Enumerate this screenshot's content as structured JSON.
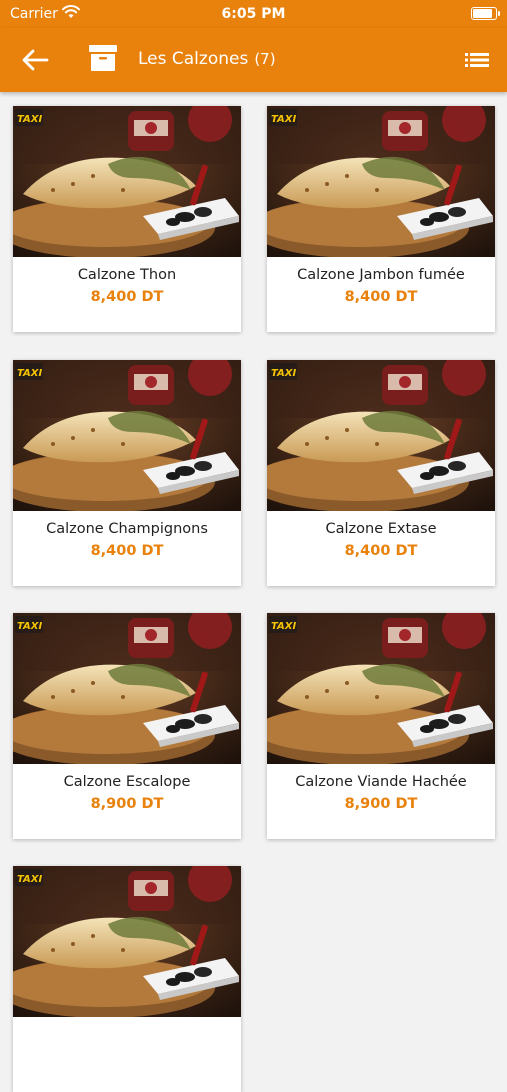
{
  "status_bar": {
    "carrier": "Carrier",
    "time": "6:05 PM",
    "battery_level": 0.9
  },
  "app_bar": {
    "title": "Les Calzones",
    "count": "(7)"
  },
  "colors": {
    "accent": "#e8820c"
  },
  "icons": {
    "back": "arrow-left-icon",
    "category": "box-icon",
    "menu": "list-icon",
    "wifi": "wifi-icon",
    "battery": "battery-icon"
  },
  "products": [
    {
      "name": "Calzone Thon",
      "price": "8,400 DT",
      "badge": "TAXI"
    },
    {
      "name": "Calzone Jambon fumée",
      "price": "8,400 DT",
      "badge": "TAXI"
    },
    {
      "name": "Calzone Champignons",
      "price": "8,400 DT",
      "badge": "TAXI"
    },
    {
      "name": "Calzone Extase",
      "price": "8,400 DT",
      "badge": "TAXI"
    },
    {
      "name": "Calzone Escalope",
      "price": "8,900 DT",
      "badge": "TAXI"
    },
    {
      "name": "Calzone Viande Hachée",
      "price": "8,900 DT",
      "badge": "TAXI"
    },
    {
      "name": "",
      "price": "",
      "badge": "TAXI"
    }
  ]
}
